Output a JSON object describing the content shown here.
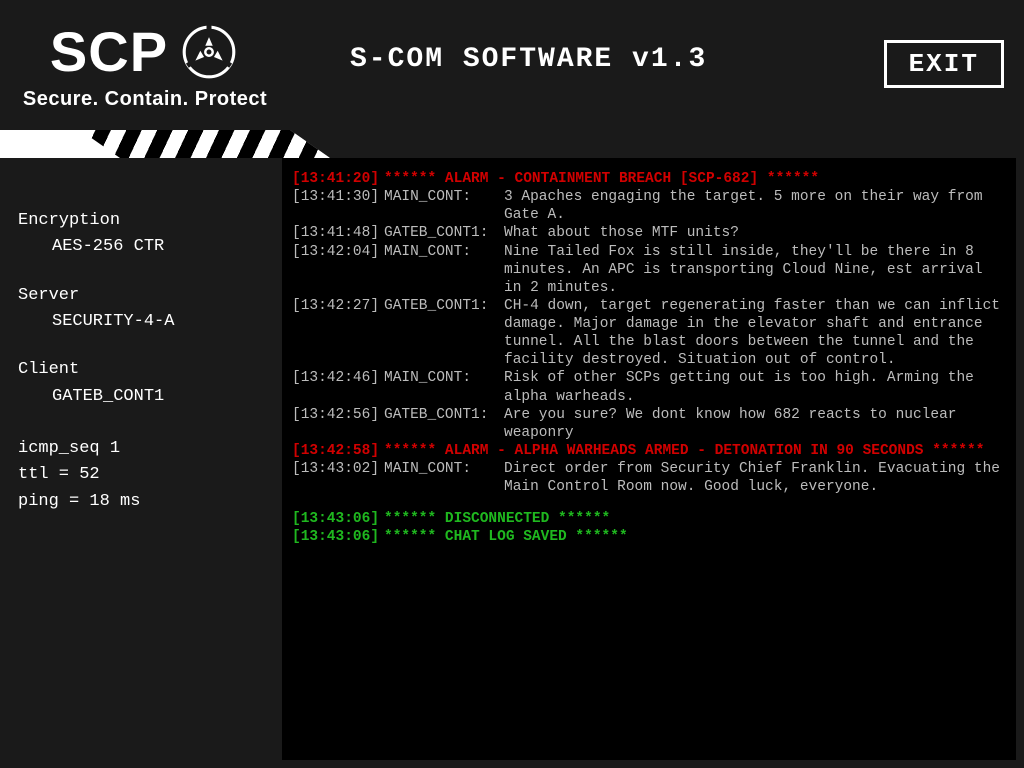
{
  "header": {
    "logo_text": "SCP",
    "tagline": "Secure. Contain. Protect",
    "title": "S-COM SOFTWARE v1.3",
    "exit_label": "EXIT"
  },
  "sidebar": {
    "encryption_label": "Encryption",
    "encryption_value": "AES-256 CTR",
    "server_label": "Server",
    "server_value": "SECURITY-4-A",
    "client_label": "Client",
    "client_value": "GATEB_CONT1",
    "icmp": "icmp_seq 1",
    "ttl": "ttl = 52",
    "ping": "ping = 18 ms"
  },
  "log": [
    {
      "time": "[13:41:20]",
      "speaker": "",
      "message": "****** ALARM - CONTAINMENT BREACH [SCP-682] ******",
      "style": "red",
      "alarm": true
    },
    {
      "time": "[13:41:30]",
      "speaker": "MAIN_CONT:",
      "message": "3 Apaches engaging the target. 5 more on their way from Gate A.",
      "style": "gray"
    },
    {
      "time": "[13:41:48]",
      "speaker": "GATEB_CONT1:",
      "message": "What about those MTF units?",
      "style": "gray"
    },
    {
      "time": "[13:42:04]",
      "speaker": "MAIN_CONT:",
      "message": "Nine Tailed Fox is still inside, they'll be there in 8 minutes. An APC is transporting Cloud Nine, est arrival in 2 minutes.",
      "style": "gray"
    },
    {
      "time": "[13:42:27]",
      "speaker": "GATEB_CONT1:",
      "message": "CH-4 down, target regenerating faster than we can inflict damage. Major damage in the elevator shaft and entrance tunnel. All the blast doors between the tunnel and the facility destroyed. Situation out of control.",
      "style": "gray"
    },
    {
      "time": "[13:42:46]",
      "speaker": "MAIN_CONT:",
      "message": "Risk of other SCPs getting out is too high. Arming the alpha warheads.",
      "style": "gray"
    },
    {
      "time": "[13:42:56]",
      "speaker": "GATEB_CONT1:",
      "message": "Are you sure? We dont know how 682 reacts to nuclear weaponry",
      "style": "gray"
    },
    {
      "time": "[13:42:58]",
      "speaker": "",
      "message": "****** ALARM - ALPHA WARHEADS ARMED - DETONATION IN 90 SECONDS ******",
      "style": "red",
      "alarm": true
    },
    {
      "time": "[13:43:02]",
      "speaker": "MAIN_CONT:",
      "message": "Direct order from Security Chief Franklin. Evacuating the Main Control Room now. Good luck, everyone.",
      "style": "gray"
    },
    {
      "spacer": true
    },
    {
      "time": "[13:43:06]",
      "speaker": "",
      "message": "****** DISCONNECTED ******",
      "style": "green",
      "alarm": true
    },
    {
      "time": "[13:43:06]",
      "speaker": "",
      "message": "****** CHAT LOG SAVED ******",
      "style": "green",
      "alarm": true
    }
  ]
}
